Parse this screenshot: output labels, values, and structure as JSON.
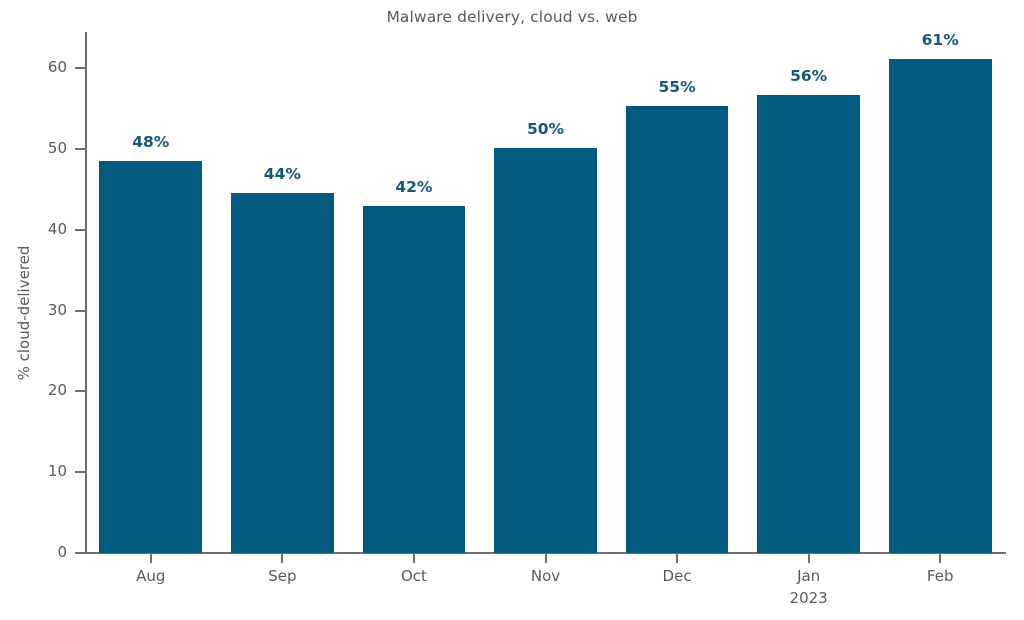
{
  "chart_data": {
    "type": "bar",
    "title": "Malware delivery, cloud vs. web",
    "xlabel": "",
    "ylabel": "% cloud-delivered",
    "categories": [
      "Aug",
      "Sep",
      "Oct",
      "Nov",
      "Dec",
      "Jan",
      "Feb"
    ],
    "category_sublabels": [
      "",
      "",
      "",
      "",
      "",
      "2023",
      ""
    ],
    "values": [
      48.5,
      44.6,
      42.9,
      50.2,
      55.4,
      56.7,
      61.2
    ],
    "data_labels": [
      "48%",
      "44%",
      "42%",
      "50%",
      "55%",
      "56%",
      "61%"
    ],
    "ylim": [
      0,
      64.5
    ],
    "yticks": [
      0,
      10,
      20,
      30,
      40,
      50,
      60
    ],
    "ytick_labels": [
      "0",
      "10",
      "20",
      "30",
      "40",
      "50",
      "60"
    ],
    "grid": false,
    "legend": null,
    "series": [
      {
        "name": "% cloud-delivered",
        "values": [
          48.5,
          44.6,
          42.9,
          50.2,
          55.4,
          56.7,
          61.2
        ]
      }
    ],
    "colors": {
      "bar": "#035a7f",
      "data_label": "#14587c",
      "axis": "#6e6e6e",
      "text": "#5a5a5a",
      "background": "#ffffff"
    }
  }
}
